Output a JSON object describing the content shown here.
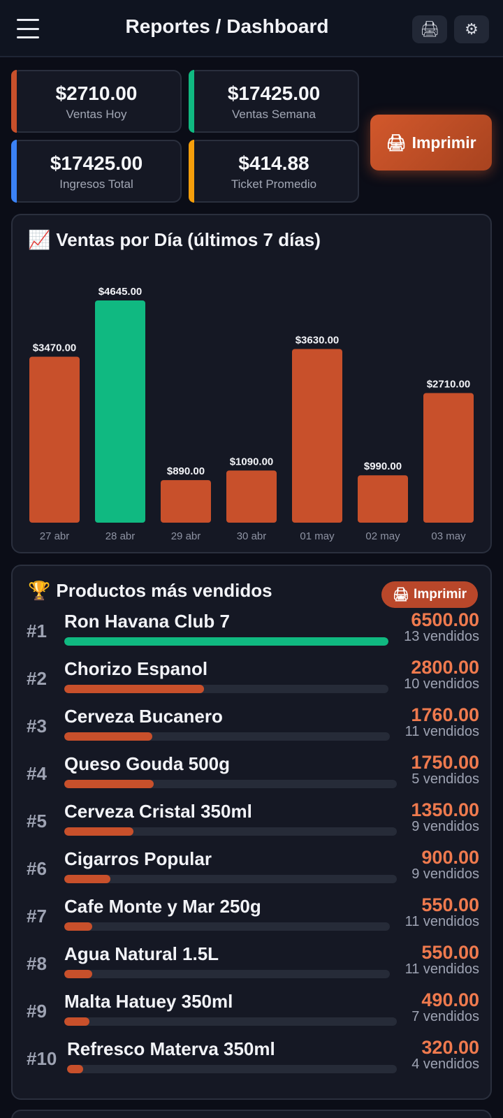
{
  "header": {
    "menu_icon": "hamburger-icon",
    "title": "Reportes / Dashboard",
    "print_icon": "🖨",
    "settings_icon": "⚙"
  },
  "kpis": [
    {
      "value": "$2710.00",
      "label": "Ventas Hoy",
      "accent": "#c8502b"
    },
    {
      "value": "$17425.00",
      "label": "Ventas Semana",
      "accent": "#10b981"
    },
    {
      "value": "$17425.00",
      "label": "Ingresos Total",
      "accent": "#3b82f6"
    },
    {
      "value": "$414.88",
      "label": "Ticket Promedio",
      "accent": "#f59e0b"
    }
  ],
  "print_button": {
    "icon": "🖨",
    "label": "Imprimir"
  },
  "sales_chart": {
    "icon": "📈",
    "title": "Ventas por Día (últimos 7 días)"
  },
  "chart_data": {
    "type": "bar",
    "title": "Ventas por Día (últimos 7 días)",
    "categories": [
      "27 abr",
      "28 abr",
      "29 abr",
      "30 abr",
      "01 may",
      "02 may",
      "03 may"
    ],
    "values": [
      3470,
      4645,
      890,
      1090,
      3630,
      990,
      2710
    ],
    "value_labels": [
      "$3470.00",
      "$4645.00",
      "$890.00",
      "$1090.00",
      "$3630.00",
      "$990.00",
      "$2710.00"
    ],
    "highlight_index": 1,
    "colors": {
      "default": "#c8502b",
      "highlight": "#10b981"
    },
    "ylim": [
      0,
      4645
    ]
  },
  "top_products": {
    "icon": "🏆",
    "title": "Productos más vendidos",
    "print_icon": "🖨",
    "print_label": "Imprimir",
    "bar_colors": {
      "top": "#10b981",
      "rest": "#c8502b"
    },
    "items": [
      {
        "rank": "#1",
        "name": "Ron Havana Club 7",
        "revenue": "6500.00",
        "units": "13 vendidos",
        "share": 1.0
      },
      {
        "rank": "#2",
        "name": "Chorizo Espanol",
        "revenue": "2800.00",
        "units": "10 vendidos",
        "share": 0.431
      },
      {
        "rank": "#3",
        "name": "Cerveza Bucanero",
        "revenue": "1760.00",
        "units": "11 vendidos",
        "share": 0.271
      },
      {
        "rank": "#4",
        "name": "Queso Gouda 500g",
        "revenue": "1750.00",
        "units": "5 vendidos",
        "share": 0.269
      },
      {
        "rank": "#5",
        "name": "Cerveza Cristal 350ml",
        "revenue": "1350.00",
        "units": "9 vendidos",
        "share": 0.208
      },
      {
        "rank": "#6",
        "name": "Cigarros Popular",
        "revenue": "900.00",
        "units": "9 vendidos",
        "share": 0.138
      },
      {
        "rank": "#7",
        "name": "Cafe Monte y Mar 250g",
        "revenue": "550.00",
        "units": "11 vendidos",
        "share": 0.085
      },
      {
        "rank": "#8",
        "name": "Agua Natural 1.5L",
        "revenue": "550.00",
        "units": "11 vendidos",
        "share": 0.085
      },
      {
        "rank": "#9",
        "name": "Malta Hatuey 350ml",
        "revenue": "490.00",
        "units": "7 vendidos",
        "share": 0.075
      },
      {
        "rank": "#10",
        "name": "Refresco Materva 350ml",
        "revenue": "320.00",
        "units": "4 vendidos",
        "share": 0.049
      }
    ]
  }
}
